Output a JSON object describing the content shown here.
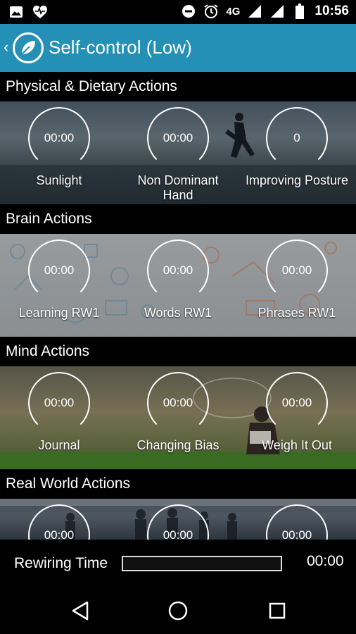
{
  "status_bar": {
    "network": "4G",
    "time": "10:56",
    "icons": [
      "image-icon",
      "heart-monitor-icon",
      "do-not-disturb-icon",
      "alarm-icon",
      "signal-icon",
      "signal-icon",
      "battery-icon"
    ]
  },
  "app_bar": {
    "title": "Self-control (Low)",
    "accent": "#2590b5"
  },
  "sections": [
    {
      "title": "Physical & Dietary Actions",
      "actions": [
        {
          "value": "00:00",
          "label": "Sunlight"
        },
        {
          "value": "00:00",
          "label": "Non Dominant Hand"
        },
        {
          "value": "0",
          "label": "Improving Posture"
        }
      ]
    },
    {
      "title": "Brain Actions",
      "actions": [
        {
          "value": "00:00",
          "label": "Learning RW1"
        },
        {
          "value": "00:00",
          "label": "Words RW1"
        },
        {
          "value": "00:00",
          "label": "Phrases RW1"
        }
      ]
    },
    {
      "title": "Mind Actions",
      "actions": [
        {
          "value": "00:00",
          "label": "Journal"
        },
        {
          "value": "00:00",
          "label": "Changing Bias"
        },
        {
          "value": "00:00",
          "label": "Weigh It Out"
        }
      ]
    },
    {
      "title": "Real World Actions",
      "actions": [
        {
          "value": "00:00",
          "label": ""
        },
        {
          "value": "00:00",
          "label": ""
        },
        {
          "value": "00:00",
          "label": ""
        }
      ]
    }
  ],
  "rewiring": {
    "label": "Rewiring Time",
    "time": "00:00",
    "progress": 0
  }
}
